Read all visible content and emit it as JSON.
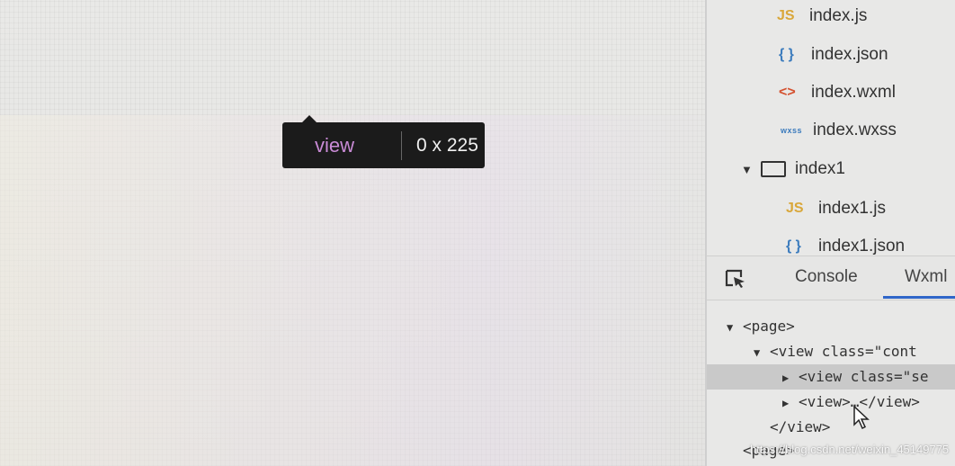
{
  "simulator": {
    "tooltip": {
      "element_name": "view",
      "size": "0 x 225"
    }
  },
  "file_tree": {
    "items": [
      {
        "icon": "js-file-icon",
        "icon_text": "JS",
        "label": "index.js"
      },
      {
        "icon": "json-file-icon",
        "icon_text": "{ }",
        "label": "index.json"
      },
      {
        "icon": "wxml-file-icon",
        "icon_text": "<>",
        "label": "index.wxml"
      },
      {
        "icon": "wxss-file-icon",
        "icon_text": "wxss",
        "label": "index.wxss"
      },
      {
        "icon": "folder-icon",
        "label": "index1"
      },
      {
        "icon": "js-file-icon",
        "icon_text": "JS",
        "label": "index1.js"
      },
      {
        "icon": "json-file-icon",
        "icon_text": "{ }",
        "label": "index1.json"
      }
    ]
  },
  "devtools": {
    "tabs": [
      {
        "label": "Console"
      },
      {
        "label": "Wxml",
        "active": true
      }
    ]
  },
  "wxml_tree": {
    "lines": [
      "<page>",
      "<view  class=\"cont",
      "<view  class=\"se",
      "<view>…</view>",
      "</view>",
      "<page>"
    ]
  },
  "watermark": "https://blog.csdn.net/weixin_45149775",
  "colors": {
    "tooltip_bg": "#1b1b1b",
    "tooltip_tag": "#c98bd6",
    "active_tab_underline": "#2f66c9",
    "selected_row": "#c9c9c9"
  }
}
